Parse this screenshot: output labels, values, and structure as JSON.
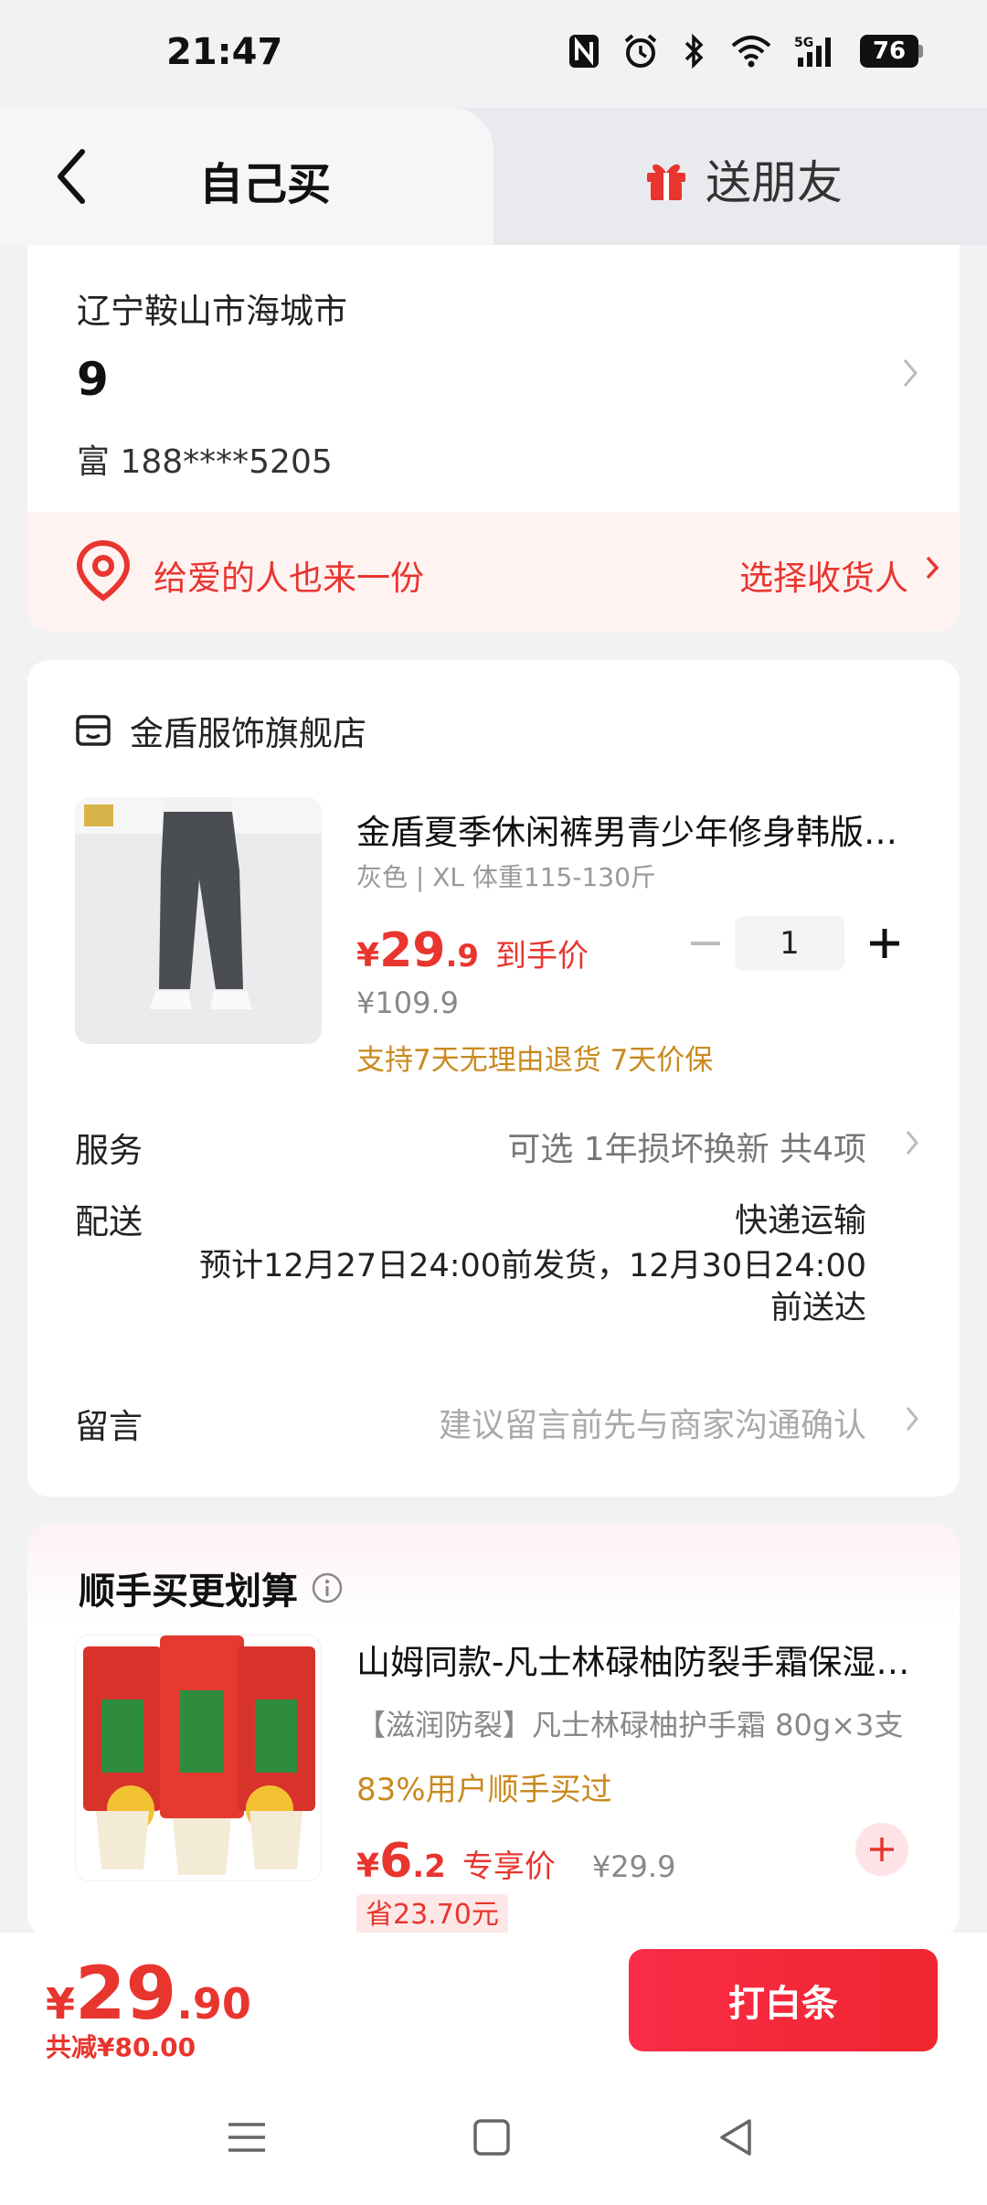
{
  "status_bar": {
    "time": "21:47",
    "battery": "76"
  },
  "tabs": {
    "self": "自己买",
    "gift": "送朋友"
  },
  "address": {
    "region": "辽宁鞍山市海城市",
    "detail": "9",
    "contact": "富  188****5205"
  },
  "gift_banner": {
    "text": "给爱的人也来一份",
    "action": "选择收货人"
  },
  "shop": {
    "name": "金盾服饰旗舰店"
  },
  "product": {
    "title": "金盾夏季休闲裤男青少年修身韩版直筒长裤",
    "spec": "灰色 | XL 体重115-130斤",
    "price_symbol": "¥",
    "price_int": "29",
    "price_dec": ".9",
    "price_tag": "到手价",
    "original_price": "¥109.9",
    "badges": "支持7天无理由退货  7天价保",
    "quantity": "1"
  },
  "service": {
    "label": "服务",
    "value": "可选 1年损坏换新 共4项"
  },
  "delivery": {
    "label": "配送",
    "method": "快递运输",
    "eta": "预计12月27日24:00前发货，12月30日24:00前送达"
  },
  "message": {
    "label": "留言",
    "placeholder": "建议留言前先与商家沟通确认"
  },
  "upsell": {
    "title": "顺手买更划算",
    "item": {
      "title": "山姆同款-凡士林碌柚防裂手霜保湿滋润",
      "subtitle": "【滋润防裂】凡士林碌柚护手霜 80g×3支",
      "stat": "83%用户顺手买过",
      "price_symbol": "¥",
      "price_int": "6",
      "price_dec": ".2",
      "price_tag": "专享价",
      "original_price": "¥29.9",
      "save": "省23.70元"
    }
  },
  "footer": {
    "total_symbol": "¥",
    "total_int": "29",
    "total_dec": ".90",
    "discount": "共减¥80.00",
    "pay_button": "打白条"
  },
  "colors": {
    "accent": "#e8352e",
    "gold": "#c98a1e",
    "pay_button": "#f52a3d"
  }
}
